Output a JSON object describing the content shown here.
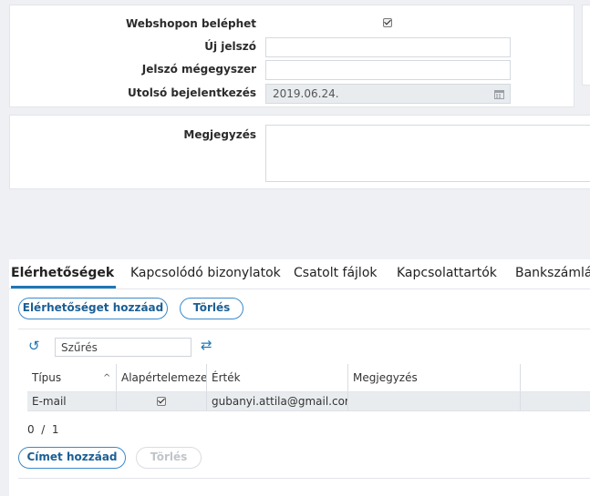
{
  "form": {
    "webshop_label": "Webshopon beléphet",
    "webshop_checked": true,
    "new_password_label": "Új jelszó",
    "new_password_value": "",
    "confirm_password_label": "Jelszó mégegyszer",
    "confirm_password_value": "",
    "last_login_label": "Utolsó bejelentkezés",
    "last_login_value": "2019.06.24.",
    "note_label": "Megjegyzés",
    "note_value": ""
  },
  "tabs": [
    {
      "label": "Elérhetőségek",
      "active": true
    },
    {
      "label": "Kapcsolódó bizonylatok",
      "active": false
    },
    {
      "label": "Csatolt fájlok",
      "active": false
    },
    {
      "label": "Kapcsolattartók",
      "active": false
    },
    {
      "label": "Bankszámlák",
      "active": false
    }
  ],
  "contacts": {
    "add_button": "Elérhetőséget hozzáad",
    "delete_button": "Törlés",
    "filter_value": "Szűrés",
    "columns": [
      "Típus",
      "Alapértelemezett",
      "Érték",
      "Megjegyzés"
    ],
    "rows": [
      {
        "type": "E-mail",
        "default": true,
        "value": "gubanyi.attila@gmail.com",
        "note": ""
      }
    ],
    "pager": "0  /  1",
    "add_address_button": "Címet hozzáad",
    "delete_address_button": "Törlés"
  },
  "colors": {
    "accent": "#1f77b7",
    "button_border": "#3a8acb"
  }
}
